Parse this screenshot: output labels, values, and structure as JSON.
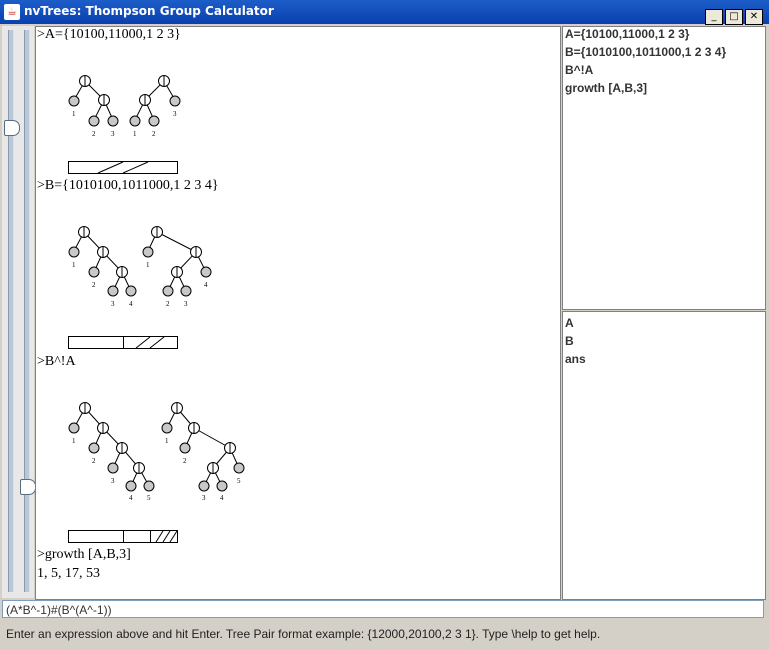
{
  "window": {
    "title": "nvTrees: Thompson Group Calculator",
    "app_icon": "java-cup-icon",
    "controls": [
      "_",
      "□",
      "✕"
    ]
  },
  "main": {
    "lines": [
      ">A={10100,11000,1 2 3}",
      ">B={1010100,1011000,1 2 3 4}",
      ">B^!A",
      ">growth [A,B,3]",
      "1, 5, 17, 53"
    ],
    "tree_labels": {
      "a_left": [
        "1",
        "2",
        "3"
      ],
      "a_right": [
        "1",
        "2",
        "3"
      ],
      "b_left": [
        "1",
        "2",
        "3",
        "4"
      ],
      "b_right": [
        "1",
        "2",
        "3",
        "4"
      ],
      "c_left": [
        "1",
        "2",
        "3",
        "4",
        "5"
      ],
      "c_right": [
        "1",
        "2",
        "3",
        "4",
        "5"
      ]
    }
  },
  "history": {
    "items": [
      "A={10100,11000,1 2 3}",
      "B={1010100,1011000,1 2 3 4}",
      "B^!A",
      "growth [A,B,3]"
    ]
  },
  "variables": {
    "items": [
      "A",
      "B",
      "ans"
    ]
  },
  "input": {
    "value": "(A*B^-1)#(B^(A^-1))"
  },
  "status": {
    "text": "Enter an expression above and hit Enter. Tree Pair format example: {12000,20100,2 3 1}. Type \\help to get help."
  },
  "colors": {
    "titlebar": "#0a3fae",
    "leaf_fill": "#c8c8c8"
  }
}
